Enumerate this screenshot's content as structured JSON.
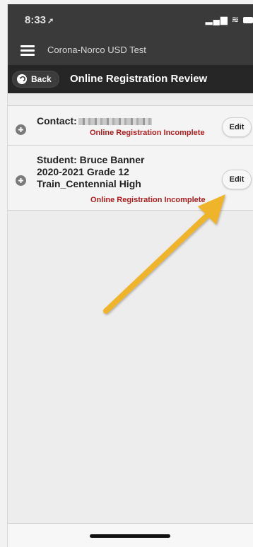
{
  "status_bar": {
    "time": "8:33",
    "location_glyph": "➚",
    "signal_glyph": "▂▄▆",
    "wifi_glyph": "≋"
  },
  "appbar": {
    "title": "Corona-Norco USD Test"
  },
  "toolbar": {
    "back_label": "Back",
    "page_title": "Online Registration Review"
  },
  "rows": {
    "contact": {
      "label": "Contact:",
      "status": "Online Registration Incomplete",
      "edit_label": "Edit"
    },
    "student": {
      "line1": "Student: Bruce Banner",
      "line2": "2020-2021 Grade 12",
      "line3": "Train_Centennial High",
      "status": "Online Registration Incomplete",
      "edit_label": "Edit"
    }
  },
  "colors": {
    "status_red": "#b01d1d",
    "arrow_yellow": "#f0b429",
    "header_dark": "#262626"
  }
}
